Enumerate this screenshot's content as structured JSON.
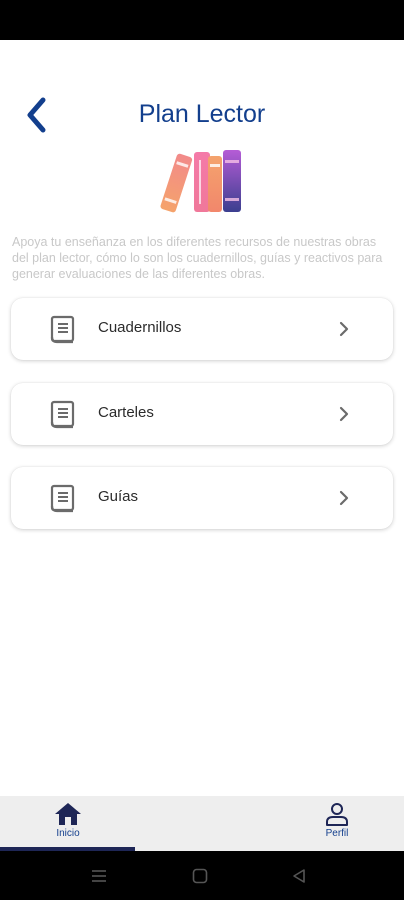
{
  "header": {
    "title": "Plan Lector"
  },
  "intro": {
    "text": "Apoya tu enseñanza en los diferentes recursos de nuestras obras del plan lector, cómo lo son los cuadernillos, guías y reactivos para generar evaluaciones de las diferentes obras."
  },
  "menu": {
    "items": [
      {
        "label": "Cuadernillos",
        "icon": "book-icon"
      },
      {
        "label": "Carteles",
        "icon": "book-icon"
      },
      {
        "label": "Guías",
        "icon": "book-icon"
      }
    ]
  },
  "bottom_nav": {
    "items": [
      {
        "label": "Inicio",
        "icon": "home-icon",
        "active": true
      },
      {
        "label": "Perfil",
        "icon": "user-icon",
        "active": false
      }
    ]
  },
  "colors": {
    "primary": "#133f8d",
    "text": "#2b2b2b",
    "muted": "#c8c8c8",
    "nav_bg": "#eeeeee",
    "indicator": "#1e2656"
  }
}
